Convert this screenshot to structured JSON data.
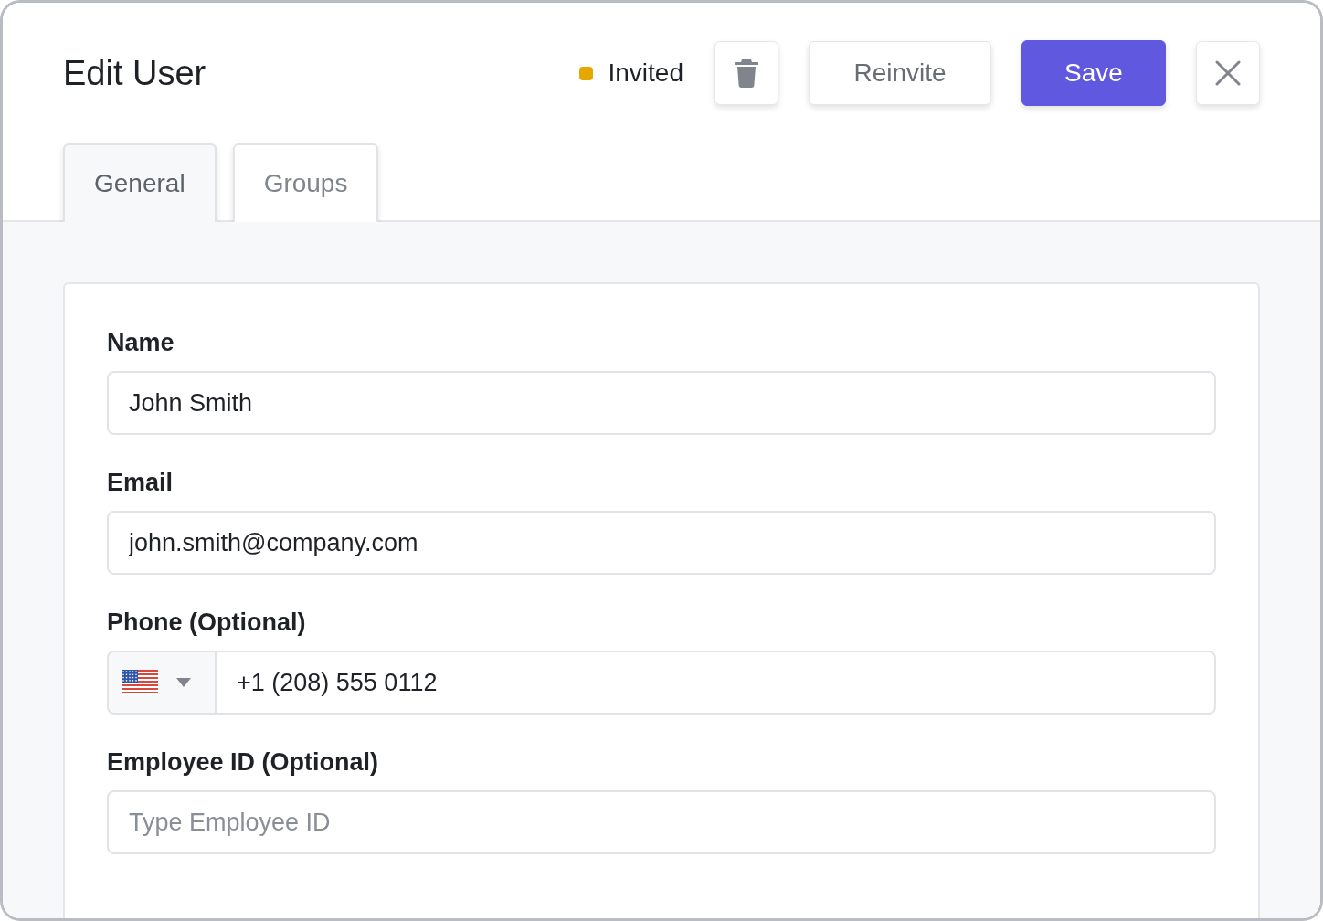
{
  "dialog": {
    "title": "Edit User",
    "status": {
      "label": "Invited",
      "color": "#e5a800"
    },
    "buttons": [
      {
        "kind": "delete"
      },
      {
        "kind": "secondary",
        "label": "Reinvite"
      },
      {
        "kind": "primary",
        "label": "Save"
      },
      {
        "kind": "close"
      }
    ]
  },
  "tabs": [
    {
      "label": "General",
      "selected": true
    },
    {
      "label": "Groups",
      "selected": false
    }
  ],
  "fields": [
    {
      "kind": "text",
      "label": "Name",
      "value": "John Smith"
    },
    {
      "kind": "text",
      "label": "Email",
      "value": "john.smith@company.com"
    },
    {
      "kind": "phone",
      "label": "Phone (Optional)",
      "value": "+1 (208) 555 0112"
    },
    {
      "kind": "text",
      "label": "Employee ID (Optional)",
      "placeholder": "Type Employee ID"
    }
  ]
}
